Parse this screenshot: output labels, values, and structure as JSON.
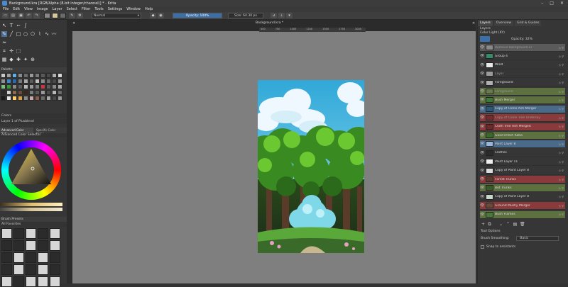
{
  "window": {
    "title": "Background.kra [RGB/Alpha (8-bit integer/channel)] * - Krita",
    "buttons": [
      "–",
      "□",
      "✕"
    ]
  },
  "menu": [
    "File",
    "Edit",
    "View",
    "Image",
    "Layer",
    "Select",
    "Filter",
    "Tools",
    "Settings",
    "Window",
    "Help"
  ],
  "toolbar": {
    "blend_mode": "Normal",
    "opacity_label": "Opacity: 100%",
    "size_label": "Size: 64.30 px"
  },
  "left": {
    "palette_header": "Palette",
    "palette_name": "Colors",
    "palette_layer_label": "Layer 1 of Plusblend",
    "color_tab_advanced": "Advanced Color Sele...",
    "color_tab_specific": "Specific Color Selec...",
    "selector_header": "Advanced Color Selector",
    "brush_header": "Brush Presets",
    "brush_tag": "All Favorites"
  },
  "document": {
    "tab": "Background.kra *",
    "ruler": [
      "500",
      "750",
      "1000",
      "1250",
      "1500",
      "1750",
      "2000"
    ]
  },
  "right": {
    "tabs": [
      "Layers",
      "Overview",
      "Grid & Guides"
    ],
    "layers_header": "Layers",
    "blend": "Color Light (KY)",
    "opacity": "Opacity: 32%",
    "layers": [
      {
        "name": "Remove Background.kl",
        "color": "#5a5a5a",
        "thumb": "#8a8a8a",
        "dim": true
      },
      {
        "name": "Group 4",
        "color": "#363636",
        "thumb": "#3a8a6a",
        "dim": false
      },
      {
        "name": "Wind",
        "color": "#363636",
        "thumb": "#e8e8e8",
        "dim": false
      },
      {
        "name": "Layer",
        "color": "#363636",
        "thumb": "#9a9a9a",
        "dim": true
      },
      {
        "name": "Foreground",
        "color": "#363636",
        "thumb": "#b0b0b0",
        "dim": false
      },
      {
        "name": "Foreground",
        "color": "#5c7040",
        "thumb": "#6a7a50",
        "dim": true
      },
      {
        "name": "Bush Merger",
        "color": "#5c7040",
        "thumb": "#3c7a3c",
        "dim": false
      },
      {
        "name": "Copy of Clone Ash Merger",
        "color": "#4a6a8a",
        "thumb": "#2a5a7a",
        "dim": false
      },
      {
        "name": "Copy of Clone Tree Underlay",
        "color": "#8a3a3a",
        "thumb": "#7a2a2a",
        "dim": true
      },
      {
        "name": "Cloth Tree Ash Merged",
        "color": "#8a3a3a",
        "thumb": "#6a2a2a",
        "dim": false
      },
      {
        "name": "Good Infect Ratio",
        "color": "#5c7040",
        "thumb": "#3c6a2c",
        "dim": false
      },
      {
        "name": "Paint Layer 8",
        "color": "#4a6a8a",
        "thumb": "#9ab6d6",
        "dim": false
      },
      {
        "name": "Clothes",
        "color": "#363636",
        "thumb": "#2a2a2a",
        "dim": false
      },
      {
        "name": "Paint Layer 11",
        "color": "#363636",
        "thumb": "#f0f0f0",
        "dim": false
      },
      {
        "name": "Copy of Paint Layer 8",
        "color": "#363636",
        "thumb": "#dcdcdc",
        "dim": false
      },
      {
        "name": "Forest Trunks",
        "color": "#8a3a3a",
        "thumb": "#5a3a2a",
        "dim": false
      },
      {
        "name": "Bot Trunks",
        "color": "#5c7040",
        "thumb": "#3a5a2a",
        "dim": false
      },
      {
        "name": "Copy of Paint Layer 8",
        "color": "#363636",
        "thumb": "#c8d8c8",
        "dim": false
      },
      {
        "name": "Ground Mushy Merger",
        "color": "#8a3a3a",
        "thumb": "#6a4a3a",
        "dim": false
      },
      {
        "name": "Bush Flames",
        "color": "#5c7040",
        "thumb": "#4a7a3a",
        "dim": false
      }
    ],
    "tool_header": "Tool Options",
    "tool_label": "Brush Smoothing:",
    "tool_value": "Basic",
    "snap_label": "Snap to assistants"
  },
  "colors": {
    "accent": "#4f6f96",
    "sky": "#5ac8e8",
    "foliage": "#3f9a2a",
    "blossom": "#7fd8e8"
  },
  "icons": [
    "save-icon",
    "undo-icon",
    "redo-icon",
    "brush-icon",
    "eye-icon",
    "lock-icon",
    "plus-icon",
    "trash-icon"
  ]
}
